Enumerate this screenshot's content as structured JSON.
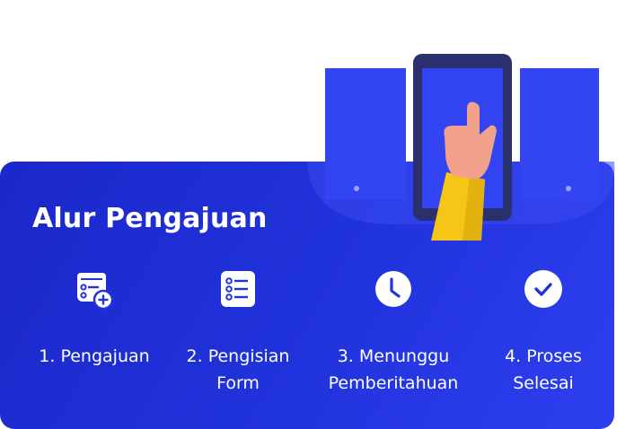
{
  "title": "Alur Pengajuan",
  "steps": [
    {
      "icon": "calendar-add-icon",
      "label_lines": [
        "1. Pengajuan"
      ]
    },
    {
      "icon": "form-list-icon",
      "label_lines": [
        "2. Pengisian",
        "Form"
      ]
    },
    {
      "icon": "clock-icon",
      "label_lines": [
        "3. Menunggu",
        "Pemberitahuan"
      ]
    },
    {
      "icon": "check-circle-icon",
      "label_lines": [
        "4. Proses",
        "Selesai"
      ]
    }
  ],
  "colors": {
    "card": "#2133dc",
    "panel": "#3344f2",
    "phone": "#2a2f6e",
    "sleeve": "#f5c518",
    "hand": "#f2a28c"
  }
}
